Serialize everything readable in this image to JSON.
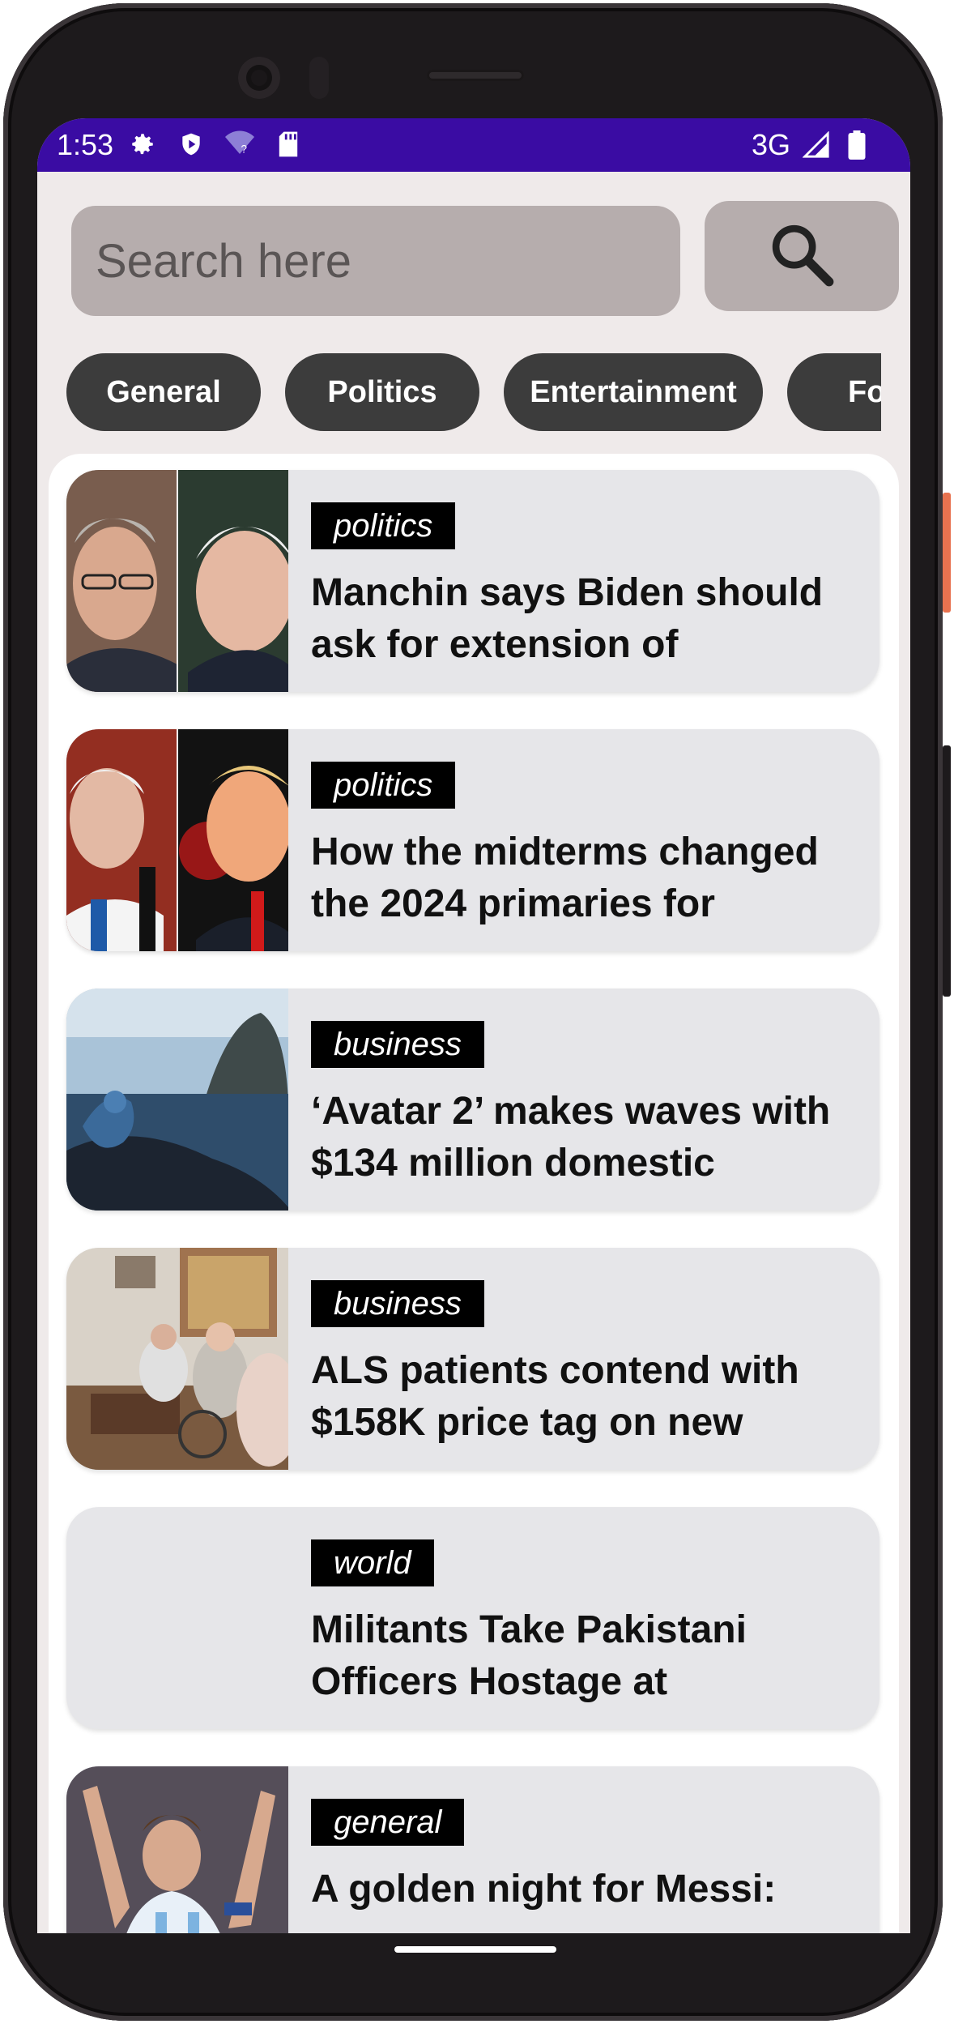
{
  "status_bar": {
    "time": "1:53",
    "network": "3G",
    "left_icons": [
      "gear-icon",
      "shield-icon",
      "wifi-unknown-icon",
      "sd-card-icon"
    ],
    "right_icons": [
      "signal-icon",
      "battery-icon"
    ],
    "color": "#3a0ca3"
  },
  "search": {
    "placeholder": "Search here",
    "button_icon": "search-icon"
  },
  "categories": [
    "General",
    "Politics",
    "Entertainment",
    "Fo"
  ],
  "articles": [
    {
      "tag": "politics",
      "title": "Manchin says Biden should ask for extension of",
      "thumb": "two-portraits"
    },
    {
      "tag": "politics",
      "title": "How the midterms changed the 2024 primaries for",
      "thumb": "two-portraits"
    },
    {
      "tag": "business",
      "title": "‘Avatar 2’ makes waves with $134 million domestic",
      "thumb": "ocean-scene"
    },
    {
      "tag": "business",
      "title": "ALS patients contend with $158K price tag on new",
      "thumb": "living-room"
    },
    {
      "tag": "world",
      "title": "Militants Take Pakistani Officers Hostage at",
      "thumb": "none"
    },
    {
      "tag": "general",
      "title": "A golden night for Messi:",
      "thumb": "stadium-celebration"
    }
  ],
  "colors": {
    "screen_bg": "#efeaea",
    "search_bg": "#b6adad",
    "chip_bg": "#3c3c3c",
    "card_bg": "#e6e6e9",
    "tag_bg": "#000000",
    "accent_side_button": "#e8724f"
  }
}
